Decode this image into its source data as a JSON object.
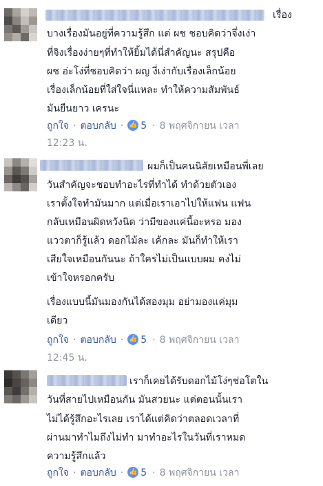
{
  "comments": [
    {
      "first_line_tail": "เรื่อง",
      "lines": [
        "บางเรื่องมันอยู่ที่ความรู้สึก แต่ ผช ชอบคิดว่าจึ่งเง่า",
        "ที่จิงเรื่องง่ายๆที่ทำให้ยิ้มได้นี่สำคัญนะ สรุปคือ",
        "ผช อ่ะโง่ที่ชอบคิดว่า ผญ งี่เง่ากับเรื่องเล็กน้อย",
        "เรื่องเล็กน้อยที่ใส่ใจนี่แหละ ทำให้ความสัมพันธ์",
        "มันยืนยาว เครนะ"
      ],
      "like_label": "ถูกใจ",
      "reply_label": "ตอบกลับ",
      "reaction_icon": "thumbs-up-icon",
      "reaction_count": "5",
      "date": "8 พฤศจิกายน เวลา",
      "time": "12:23 น."
    },
    {
      "first_line_tail": "ผมก็เป็นคนนิสัยเหมือนพี่เลย",
      "lines": [
        "วันสำคัญจะชอบทำอะไรที่ทำได้ ทำด้วยตัวเอง",
        "เราตั้งใจทำมันมาก แต่เมื่อเราเอาไปให้แฟน แฟน",
        "กลับเหมือนผิดหวังนิด ว่ามีของแค่นี้อะหรอ มอง",
        "แววตาก็รู้แล้ว ดอกไม้ละ เค้กละ มันก็ทำให้เรา",
        "เสียใจเหมือนกันนะ ถ้าใครไม่เป็นแบบผม คงไม่",
        "เข้าใจหรอกครับ"
      ],
      "paragraph2": [
        "เรื่องแบบนี้มันมองกันได้สองมุม อย่ามองแค่มุม",
        "เดียว"
      ],
      "like_label": "ถูกใจ",
      "reply_label": "ตอบกลับ",
      "reaction_icon": "thumbs-up-icon",
      "reaction_count": "5",
      "date": "8 พฤศจิกายน เวลา",
      "time": "12:45 น."
    },
    {
      "first_line_tail": "เราก็เคยได้รับดอกไม้โง่ๆช่อโตใน",
      "lines": [
        "วันที่สายไปเหมือนกัน มันสวยนะ แต่ตอนนั้นเรา",
        "ไม่ได้รู้สึกอะไรเลย เราได้แต่คิดว่าตลอดเวลาที่",
        "ผ่านมาทำไมถึงไม่ทำ มาทำอะไรในวันที่เราหมด",
        "ความรู้สึกแล้ว"
      ],
      "like_label": "ถูกใจ",
      "reply_label": "ตอบกลับ",
      "reaction_icon": "thumbs-up-icon",
      "reaction_count": "5",
      "date": "8 พฤศจิกายน เวลา"
    }
  ],
  "colors": {
    "link": "#365899",
    "meta": "#90949c",
    "text": "#1d2129",
    "like_badge": "#5890ff"
  }
}
